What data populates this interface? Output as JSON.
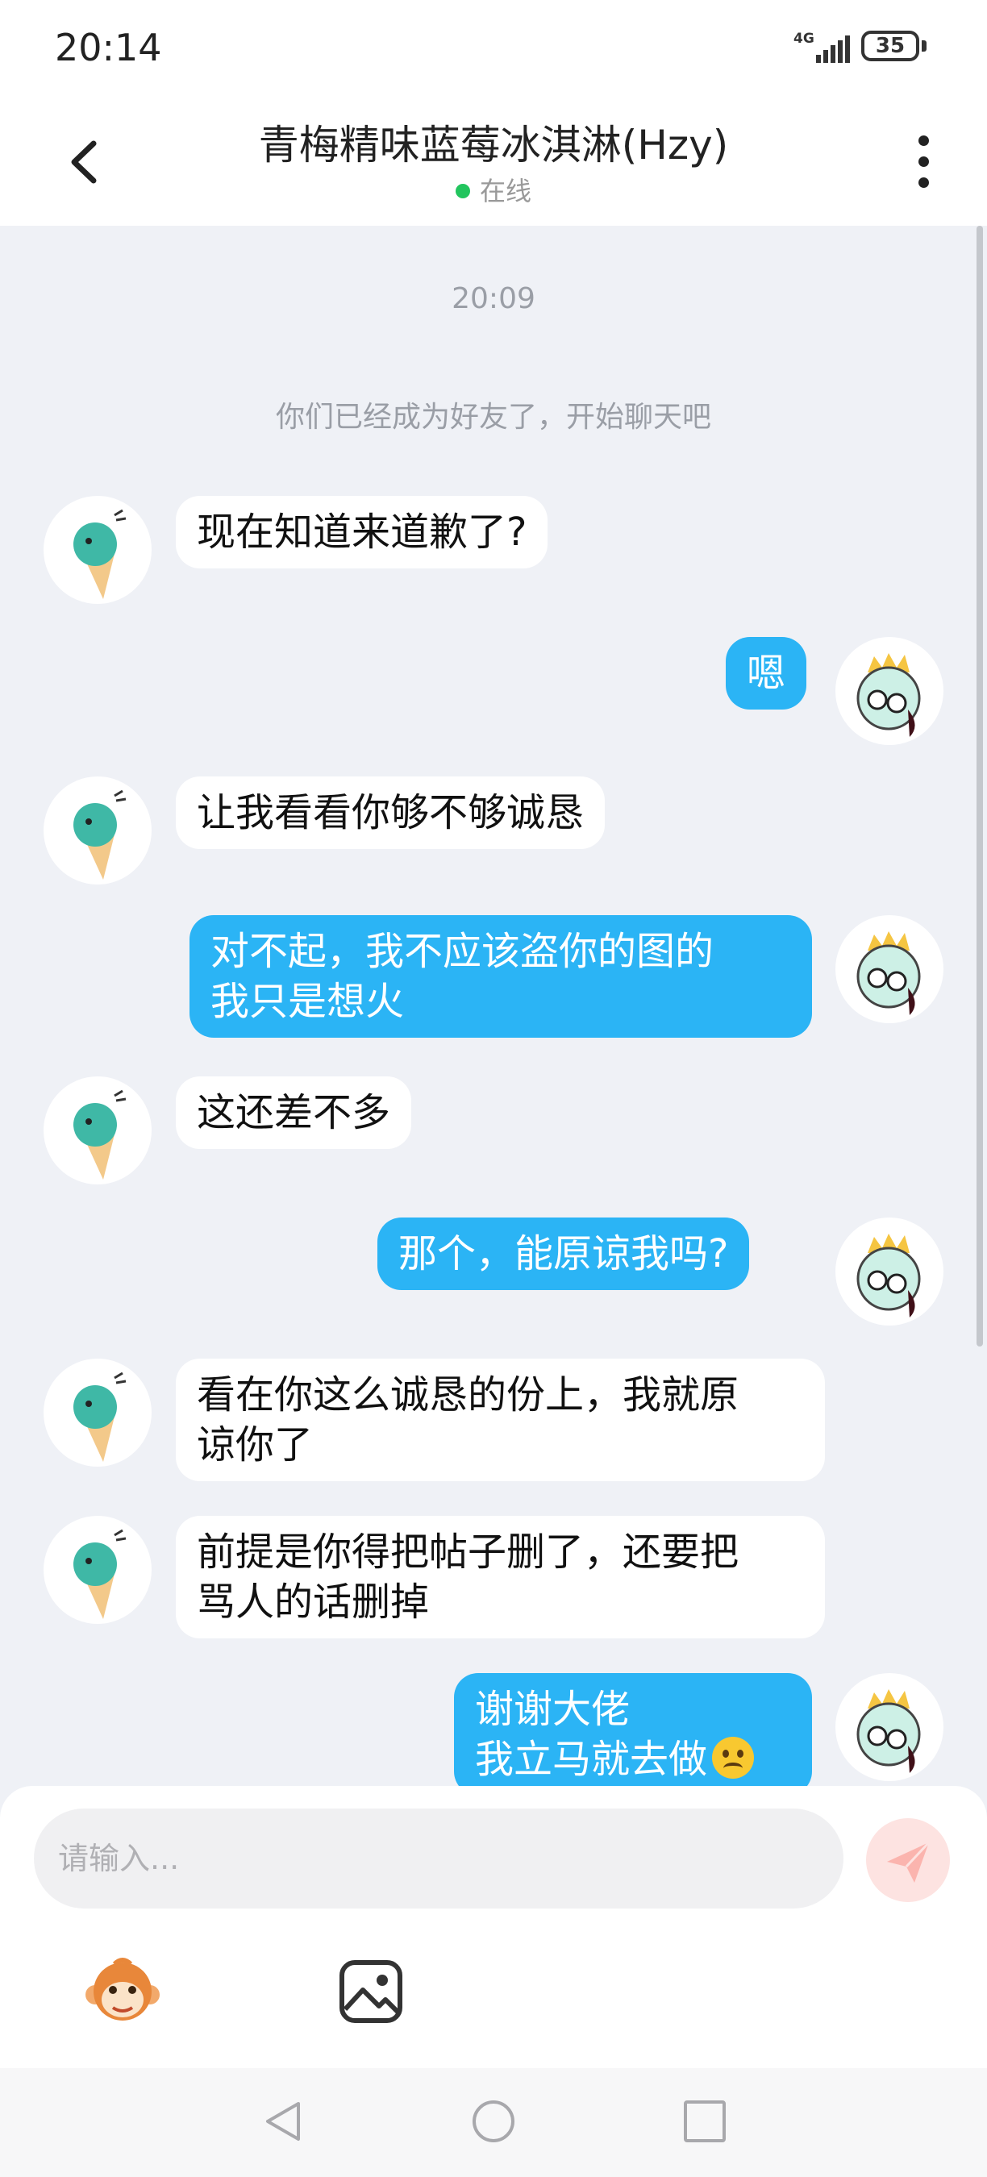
{
  "status_bar": {
    "time": "20:14",
    "network": "4G",
    "battery": "35"
  },
  "header": {
    "title": "青梅精味蓝莓冰淇淋(Hzy)",
    "status": "在线",
    "online_color": "#22c55e"
  },
  "chat": {
    "timestamp": "20:09",
    "system_notice": "你们已经成为好友了，开始聊天吧",
    "messages": [
      {
        "from": "them",
        "text": "现在知道来道歉了?"
      },
      {
        "from": "me",
        "text": "嗯"
      },
      {
        "from": "them",
        "text": "让我看看你够不够诚恳"
      },
      {
        "from": "me",
        "text": "对不起，我不应该盗你的图的\n我只是想火"
      },
      {
        "from": "them",
        "text": "这还差不多"
      },
      {
        "from": "me",
        "text": "那个，能原谅我吗?"
      },
      {
        "from": "them",
        "text": "看在你这么诚恳的份上，我就原\n谅你了"
      },
      {
        "from": "them",
        "text": "前提是你得把帖子删了，还要把\n骂人的话删掉"
      },
      {
        "from": "me",
        "text": "谢谢大佬\n我立马就去做",
        "emoji": "frowning-face"
      }
    ]
  },
  "composer": {
    "placeholder": "请输入..."
  },
  "colors": {
    "outgoing_bubble": "#2bb4f5",
    "incoming_bubble": "#ffffff",
    "send_button": "#fde3e1"
  }
}
